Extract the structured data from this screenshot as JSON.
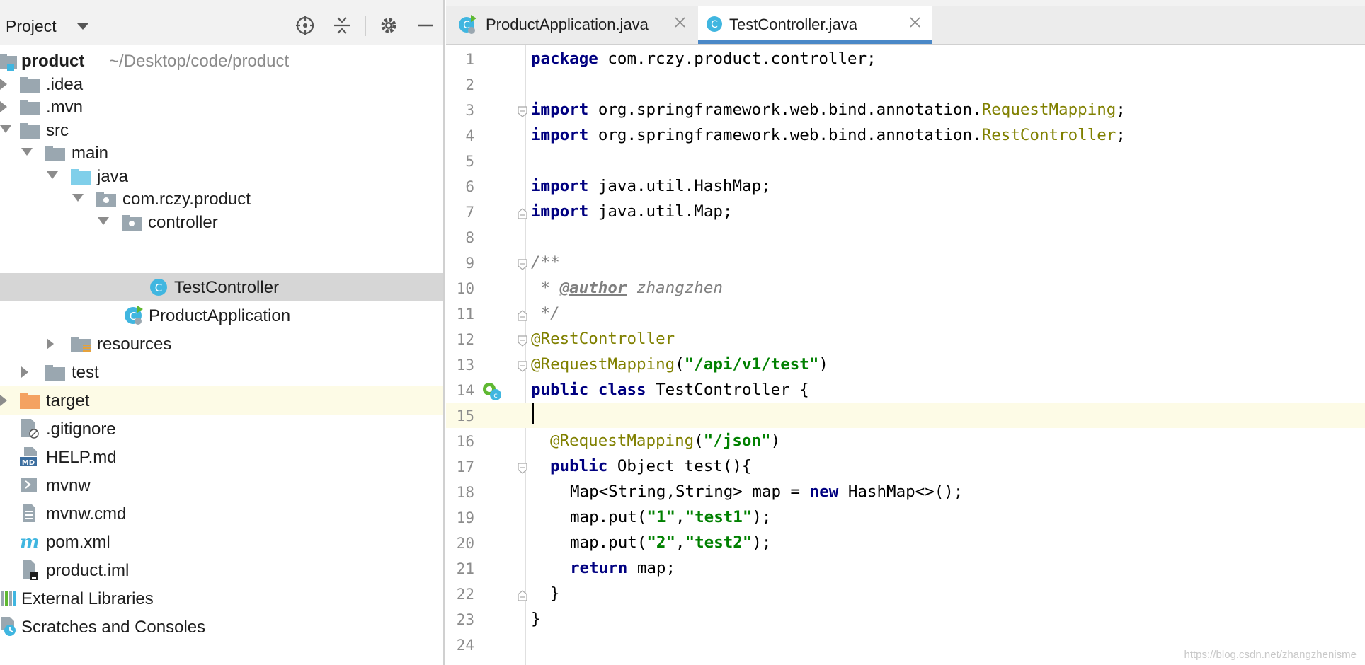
{
  "project_panel": {
    "title": "Project",
    "root": {
      "name": "product",
      "path": "~/Desktop/code/product"
    },
    "items": [
      {
        "label": ".idea"
      },
      {
        "label": ".mvn"
      },
      {
        "label": "src"
      },
      {
        "label": "main"
      },
      {
        "label": "java"
      },
      {
        "label": "com.rczy.product"
      },
      {
        "label": "controller"
      },
      {
        "label": "TestController",
        "selected": true
      },
      {
        "label": "ProductApplication"
      },
      {
        "label": "resources"
      },
      {
        "label": "test"
      },
      {
        "label": "target"
      },
      {
        "label": ".gitignore"
      },
      {
        "label": "HELP.md"
      },
      {
        "label": "mvnw"
      },
      {
        "label": "mvnw.cmd"
      },
      {
        "label": "pom.xml"
      },
      {
        "label": "product.iml"
      },
      {
        "label": "External Libraries"
      },
      {
        "label": "Scratches and Consoles"
      }
    ]
  },
  "editor": {
    "tabs": [
      {
        "label": "ProductApplication.java",
        "active": false
      },
      {
        "label": "TestController.java",
        "active": true
      }
    ],
    "current_line": 15,
    "lines": [
      {
        "n": "1"
      },
      {
        "n": "2"
      },
      {
        "n": "3"
      },
      {
        "n": "4"
      },
      {
        "n": "5"
      },
      {
        "n": "6"
      },
      {
        "n": "7"
      },
      {
        "n": "8"
      },
      {
        "n": "9"
      },
      {
        "n": "10"
      },
      {
        "n": "11"
      },
      {
        "n": "12"
      },
      {
        "n": "13"
      },
      {
        "n": "14"
      },
      {
        "n": "15"
      },
      {
        "n": "16"
      },
      {
        "n": "17"
      },
      {
        "n": "18"
      },
      {
        "n": "19"
      },
      {
        "n": "20"
      },
      {
        "n": "21"
      },
      {
        "n": "22"
      },
      {
        "n": "23"
      },
      {
        "n": "24"
      }
    ],
    "code": {
      "l1_kw": "package",
      "l1_rest": " com.rczy.product.controller;",
      "l3_kw": "import",
      "l3_pkg": " org.springframework.web.bind.annotation.",
      "l3_cls": "RequestMapping",
      "l3_end": ";",
      "l4_kw": "import",
      "l4_pkg": " org.springframework.web.bind.annotation.",
      "l4_cls": "RestController",
      "l4_end": ";",
      "l6_kw": "import",
      "l6_rest": " java.util.HashMap;",
      "l7_kw": "import",
      "l7_rest": " java.util.Map;",
      "l9": "/**",
      "l10_star": " * ",
      "l10_tag": "@author",
      "l10_name": " zhangzhen",
      "l11": " */",
      "l12": "@RestController",
      "l13_ann": "@RequestMapping",
      "l13_open": "(",
      "l13_str": "\"/api/v1/test\"",
      "l13_close": ")",
      "l14_kw1": "public",
      "l14_sp": " ",
      "l14_kw2": "class",
      "l14_rest": " TestController {",
      "l16_ann": "@RequestMapping",
      "l16_open": "(",
      "l16_str": "\"/json\"",
      "l16_close": ")",
      "l17_kw": "public",
      "l17_rest": " Object test(){",
      "l18_a": "Map<String,String> map = ",
      "l18_kw": "new",
      "l18_b": " HashMap<>();",
      "l19_a": "map.put(",
      "l19_s1": "\"1\"",
      "l19_c": ",",
      "l19_s2": "\"test1\"",
      "l19_e": ");",
      "l20_a": "map.put(",
      "l20_s1": "\"2\"",
      "l20_c": ",",
      "l20_s2": "\"test2\"",
      "l20_e": ");",
      "l21_kw": "return",
      "l21_rest": " map;",
      "l22": "}",
      "l23": "}"
    }
  },
  "watermark": "https://blog.csdn.net/zhangzhenisme",
  "colors": {
    "keyword": "#000080",
    "annotation": "#808000",
    "string": "#008000",
    "comment": "#808080",
    "selection": "#d6d6d6",
    "current_line": "#fdfbe6",
    "tab_active_underline": "#4a88c7"
  }
}
